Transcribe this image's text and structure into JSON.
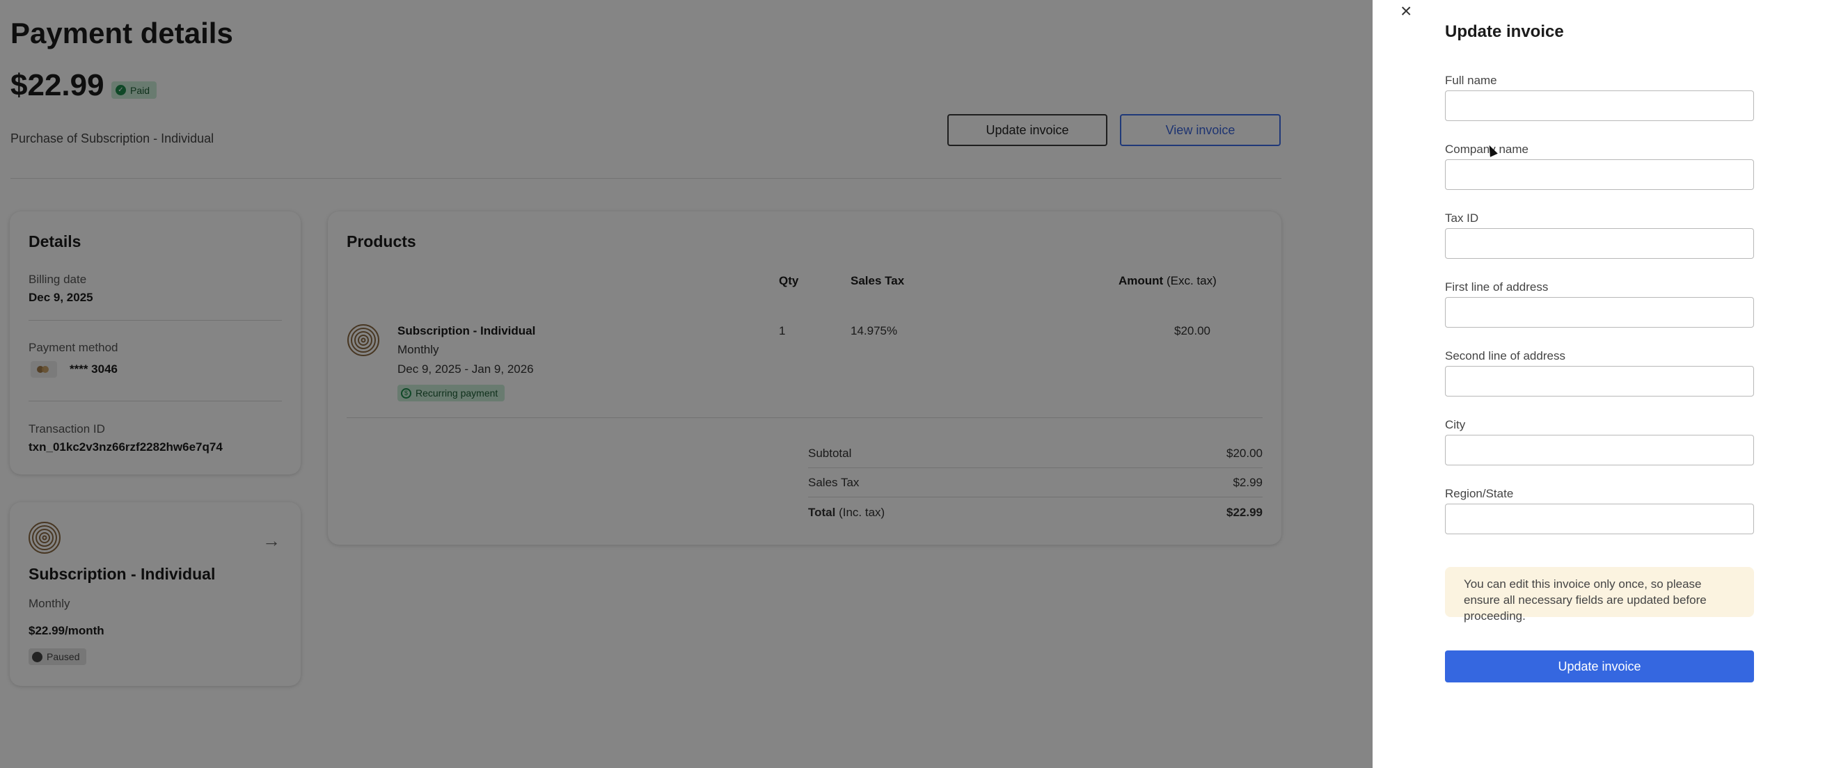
{
  "page": {
    "title": "Payment details",
    "amount": "$22.99",
    "status_badge": "Paid",
    "purchase_text": "Purchase of Subscription - Individual",
    "update_invoice_label": "Update invoice",
    "view_invoice_label": "View invoice"
  },
  "details": {
    "heading": "Details",
    "billing_date_label": "Billing date",
    "billing_date": "Dec 9, 2025",
    "payment_method_label": "Payment method",
    "card_number": "**** 3046",
    "transaction_id_label": "Transaction ID",
    "transaction_id": "txn_01kc2v3nz66rzf2282hw6e7q74"
  },
  "subscription_card": {
    "title": "Subscription - Individual",
    "interval": "Monthly",
    "price": "$22.99/month",
    "status": "Paused",
    "icon": "arrow-right-icon"
  },
  "products": {
    "heading": "Products",
    "columns": {
      "qty": "Qty",
      "sales_tax": "Sales Tax",
      "amount_bold": "Amount",
      "amount_suffix": "(Exc. tax)"
    },
    "item": {
      "name": "Subscription - Individual",
      "interval": "Monthly",
      "period": "Dec 9, 2025 - Jan 9, 2026",
      "badge": "Recurring payment",
      "qty": "1",
      "sales_tax": "14.975%",
      "amount": "$20.00"
    },
    "totals": {
      "subtotal_label": "Subtotal",
      "subtotal": "$20.00",
      "sales_tax_label": "Sales Tax",
      "sales_tax": "$2.99",
      "total_label_bold": "Total",
      "total_label_suffix": "(Inc. tax)",
      "total": "$22.99"
    }
  },
  "drawer": {
    "title": "Update invoice",
    "fields": {
      "full_name": "Full name",
      "company_name": "Company name",
      "tax_id": "Tax ID",
      "address_line1": "First line of address",
      "address_line2": "Second line of address",
      "city": "City",
      "region": "Region/State"
    },
    "notice": "You can edit this invoice only once, so please ensure all necessary fields are updated before proceeding.",
    "submit_label": "Update invoice",
    "close_icon": "close-icon"
  },
  "colors": {
    "primary": "#3567e0",
    "paid_badge_bg": "#c9ecd6",
    "notice_bg": "#fbf3e0",
    "overlay": "rgba(0,0,0,0.48)"
  }
}
